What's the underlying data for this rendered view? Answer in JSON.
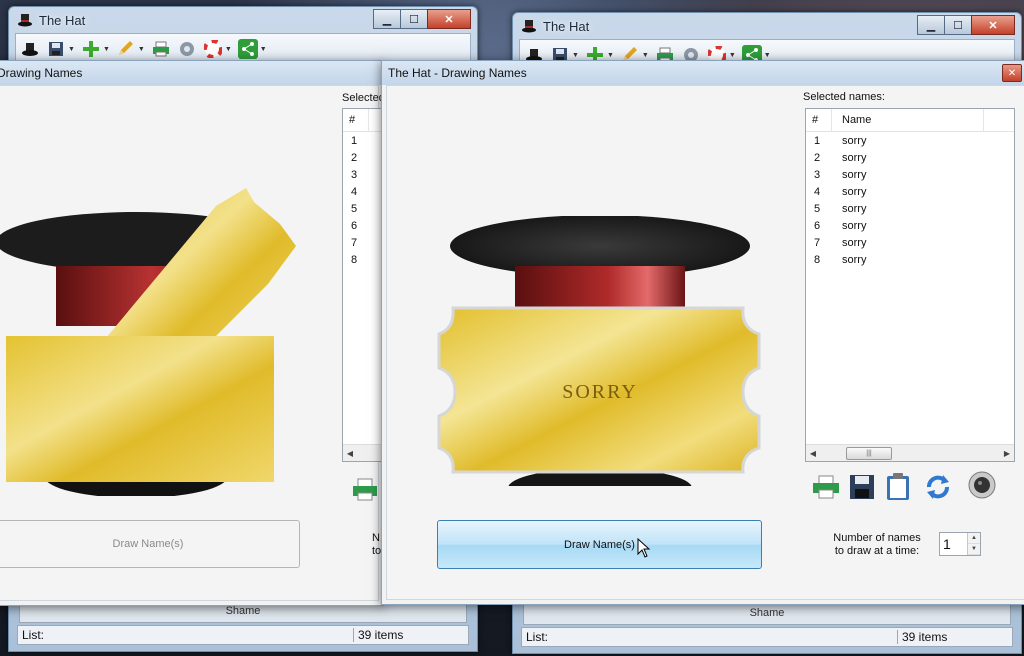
{
  "app": {
    "window_title": "The Hat",
    "status_label": "List:",
    "status_count": "39 items",
    "share_label": "Shame"
  },
  "dialog": {
    "title": "The Hat - Drawing Names",
    "selected_label": "Selected names:",
    "columns": {
      "num": "#",
      "name": "Name"
    },
    "rows": [
      {
        "num": "1",
        "name": "sorry"
      },
      {
        "num": "2",
        "name": "sorry"
      },
      {
        "num": "3",
        "name": "sorry"
      },
      {
        "num": "4",
        "name": "sorry"
      },
      {
        "num": "5",
        "name": "sorry"
      },
      {
        "num": "6",
        "name": "sorry"
      },
      {
        "num": "7",
        "name": "sorry"
      },
      {
        "num": "8",
        "name": "sorry"
      }
    ],
    "ticket_text": "SORRY",
    "draw_button": "Draw Name(s)",
    "names_count_label_1": "Number of names",
    "names_count_label_2": "to draw at a time:",
    "names_count_value": "1"
  },
  "left_dialog": {
    "title": "Drawing Names",
    "selected_label": "Selected",
    "column_num": "#",
    "row_nums": [
      "1",
      "2",
      "3",
      "4",
      "5",
      "6",
      "7",
      "8"
    ],
    "draw_button": "Draw Name(s)",
    "partial_label_1": "N",
    "partial_label_2": "to"
  },
  "colors": {
    "accent": "#a7d9f5",
    "ticket_gold": "#e8c93a",
    "hat_band": "#a52a2a"
  }
}
